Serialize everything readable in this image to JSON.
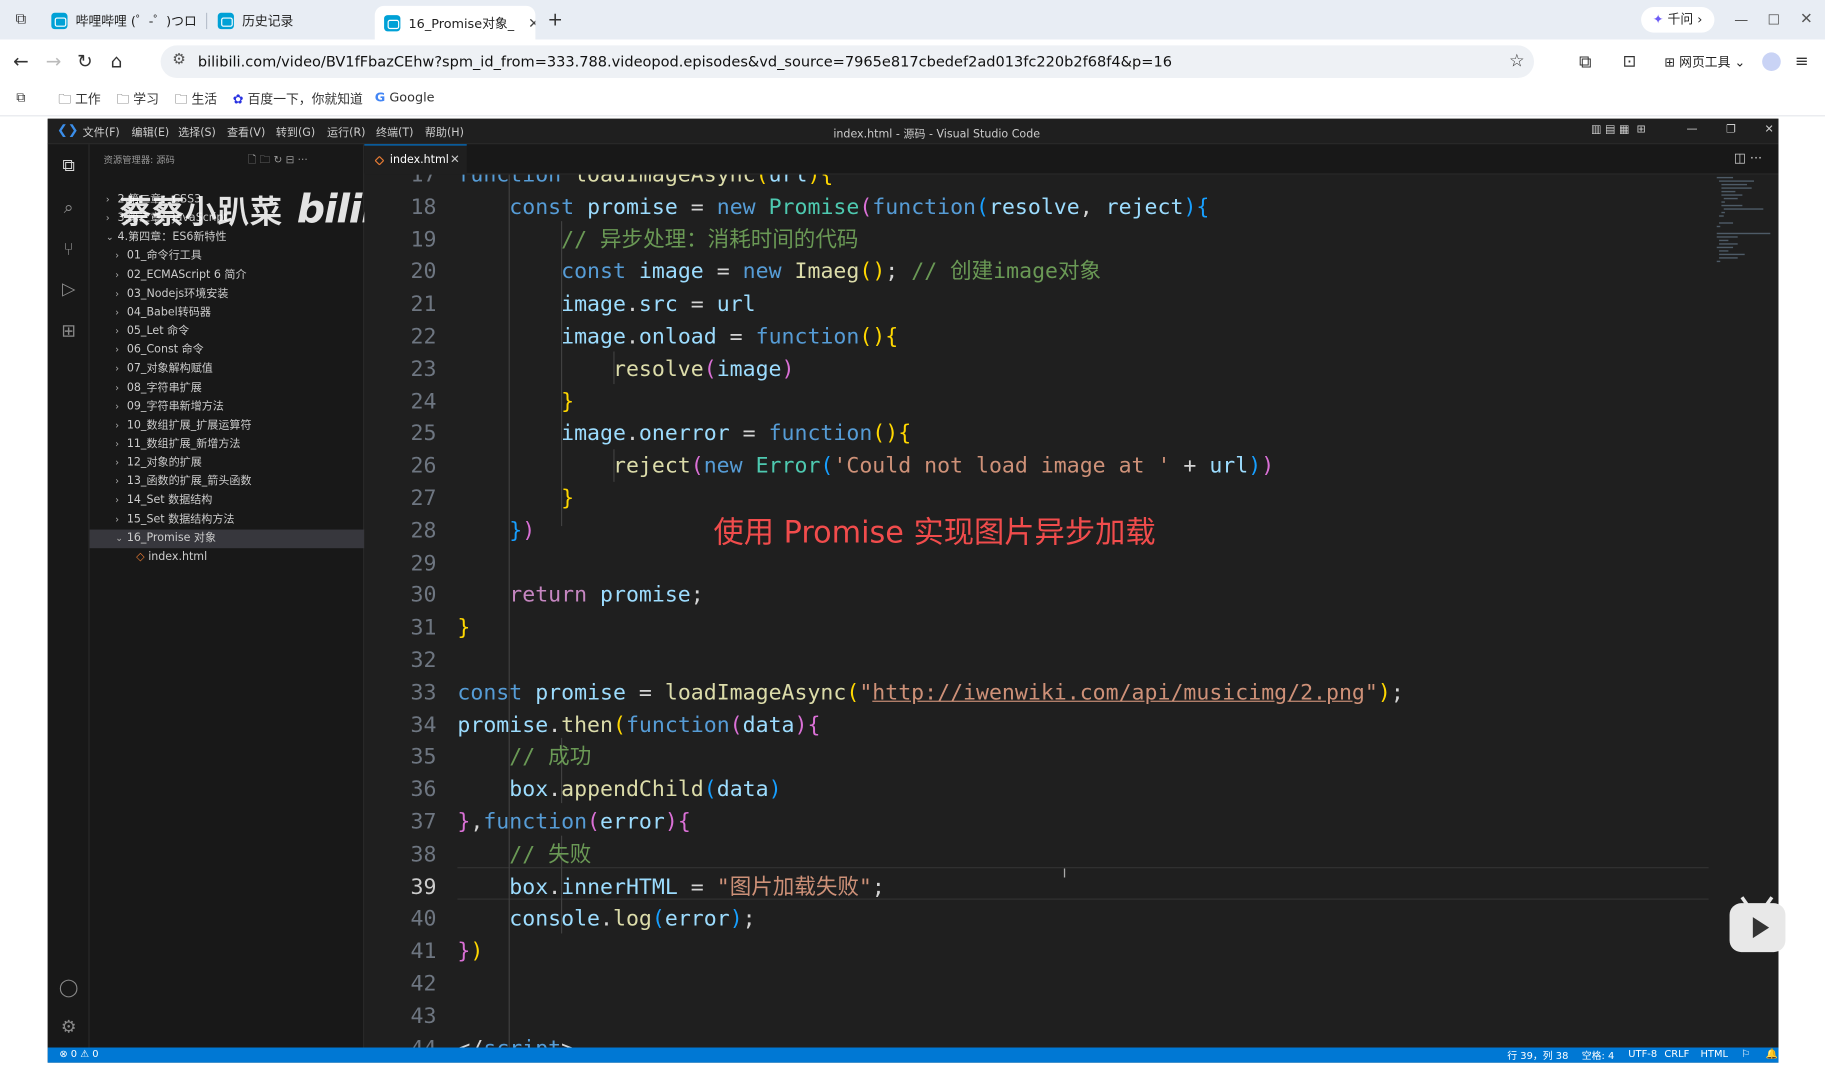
{
  "browser": {
    "tabs": [
      {
        "label": "哔哩哔哩 (゜-゜)つロ"
      },
      {
        "label": "历史记录"
      },
      {
        "label": "16_Promise对象_"
      }
    ],
    "qianwen": "千问",
    "url": "bilibili.com/video/BV1fFbazCEhw?spm_id_from=333.788.videopod.episodes&vd_source=7965e817cbedef2ad013fc220b2f68f4&p=16",
    "web_tools": "网页工具",
    "bookmarks": [
      "工作",
      "学习",
      "生活",
      "百度一下，你就知道",
      "Google"
    ]
  },
  "vscode": {
    "menu": [
      "文件(F)",
      "编辑(E)",
      "选择(S)",
      "查看(V)",
      "转到(G)",
      "运行(R)",
      "终端(T)",
      "帮助(H)"
    ],
    "title": "index.html - 源码 - Visual Studio Code",
    "explorer_header": "资源管理器: 源码",
    "tree": [
      {
        "label": "2.第二章：CSS3",
        "indent": 1,
        "chev": "›"
      },
      {
        "label": "3.第三章：JavaScript",
        "indent": 1,
        "chev": "›"
      },
      {
        "label": "4.第四章：ES6新特性",
        "indent": 1,
        "chev": "⌄"
      },
      {
        "label": "01_命令行工具",
        "indent": 2,
        "chev": "›"
      },
      {
        "label": "02_ECMAScript 6 简介",
        "indent": 2,
        "chev": "›"
      },
      {
        "label": "03_Nodejs环境安装",
        "indent": 2,
        "chev": "›"
      },
      {
        "label": "04_Babel转码器",
        "indent": 2,
        "chev": "›"
      },
      {
        "label": "05_Let 命令",
        "indent": 2,
        "chev": "›"
      },
      {
        "label": "06_Const 命令",
        "indent": 2,
        "chev": "›"
      },
      {
        "label": "07_对象解构赋值",
        "indent": 2,
        "chev": "›"
      },
      {
        "label": "08_字符串扩展",
        "indent": 2,
        "chev": "›"
      },
      {
        "label": "09_字符串新增方法",
        "indent": 2,
        "chev": "›"
      },
      {
        "label": "10_数组扩展_扩展运算符",
        "indent": 2,
        "chev": "›"
      },
      {
        "label": "11_数组扩展_新增方法",
        "indent": 2,
        "chev": "›"
      },
      {
        "label": "12_对象的扩展",
        "indent": 2,
        "chev": "›"
      },
      {
        "label": "13_函数的扩展_箭头函数",
        "indent": 2,
        "chev": "›"
      },
      {
        "label": "14_Set 数据结构",
        "indent": 2,
        "chev": "›"
      },
      {
        "label": "15_Set 数据结构方法",
        "indent": 2,
        "chev": "›"
      },
      {
        "label": "16_Promise 对象",
        "indent": 2,
        "chev": "⌄",
        "selected": true
      },
      {
        "label": "index.html",
        "indent": 3,
        "chev": "",
        "file": true
      }
    ],
    "editor_tab": "index.html",
    "watermark": {
      "name": "蔡蔡小趴菜",
      "brand": "bilibili"
    },
    "annotation": "使用 Promise 实现图片异步加载",
    "current_line": 39,
    "status": {
      "errors": "⊗ 0 ⚠ 0",
      "position": "行 39，列 38",
      "spaces": "空格: 4",
      "encoding": "UTF-8",
      "eol": "CRLF",
      "language": "HTML"
    }
  },
  "code_lines": [
    {
      "n": "17",
      "html": "<span class=\"k\">function</span> <span class=\"f\">loadImageAsync</span><span class=\"b1\">(</span><span class=\"v\">url</span><span class=\"b1\">){</span>"
    },
    {
      "n": "18",
      "html": "    <span class=\"k\">const</span> <span class=\"v\">promise</span> <span class=\"w\">=</span> <span class=\"k\">new</span> <span class=\"t\">Promise</span><span class=\"b2\">(</span><span class=\"k\">function</span><span class=\"b3\">(</span><span class=\"v\">resolve</span><span class=\"w\">,</span> <span class=\"v\">reject</span><span class=\"b3\">){</span>"
    },
    {
      "n": "19",
      "html": "        <span class=\"g\">// 异步处理：消耗时间的代码</span>"
    },
    {
      "n": "20",
      "html": "        <span class=\"k\">const</span> <span class=\"v\">image</span> <span class=\"w\">=</span> <span class=\"k\">new</span> <span class=\"f\">Imaeg</span><span class=\"b1\">()</span><span class=\"w\">;</span> <span class=\"g\">// 创建image对象</span>"
    },
    {
      "n": "21",
      "html": "        <span class=\"v\">image</span><span class=\"w\">.</span><span class=\"v\">src</span> <span class=\"w\">=</span> <span class=\"v\">url</span>"
    },
    {
      "n": "22",
      "html": "        <span class=\"v\">image</span><span class=\"w\">.</span><span class=\"v\">onload</span> <span class=\"w\">=</span> <span class=\"k\">function</span><span class=\"b1\">(){</span>"
    },
    {
      "n": "23",
      "html": "            <span class=\"f\">resolve</span><span class=\"b2\">(</span><span class=\"v\">image</span><span class=\"b2\">)</span>"
    },
    {
      "n": "24",
      "html": "        <span class=\"b1\">}</span>"
    },
    {
      "n": "25",
      "html": "        <span class=\"v\">image</span><span class=\"w\">.</span><span class=\"v\">onerror</span> <span class=\"w\">=</span> <span class=\"k\">function</span><span class=\"b1\">(){</span>"
    },
    {
      "n": "26",
      "html": "            <span class=\"f\">reject</span><span class=\"b2\">(</span><span class=\"k\">new</span> <span class=\"t\">Error</span><span class=\"b3\">(</span><span class=\"s\">'Could not load image at '</span> <span class=\"w\">+</span> <span class=\"v\">url</span><span class=\"b3\">)</span><span class=\"b2\">)</span>"
    },
    {
      "n": "27",
      "html": "        <span class=\"b1\">}</span>"
    },
    {
      "n": "28",
      "html": "    <span class=\"b3\">}</span><span class=\"b2\">)</span>"
    },
    {
      "n": "29",
      "html": ""
    },
    {
      "n": "30",
      "html": "    <span class=\"c\">return</span> <span class=\"v\">promise</span><span class=\"w\">;</span>"
    },
    {
      "n": "31",
      "html": "<span class=\"b1\">}</span>"
    },
    {
      "n": "32",
      "html": ""
    },
    {
      "n": "33",
      "html": "<span class=\"k\">const</span> <span class=\"v\">promise</span> <span class=\"w\">=</span> <span class=\"f\">loadImageAsync</span><span class=\"b1\">(</span><span class=\"s\">\"<span class=\"u\">http://iwenwiki.com/api/musicimg/2.png</span>\"</span><span class=\"b1\">)</span><span class=\"w\">;</span>"
    },
    {
      "n": "34",
      "html": "<span class=\"v\">promise</span><span class=\"w\">.</span><span class=\"f\">then</span><span class=\"b1\">(</span><span class=\"k\">function</span><span class=\"b2\">(</span><span class=\"v\">data</span><span class=\"b2\">){</span>"
    },
    {
      "n": "35",
      "html": "    <span class=\"g\">// 成功</span>"
    },
    {
      "n": "36",
      "html": "    <span class=\"v\">box</span><span class=\"w\">.</span><span class=\"f\">appendChild</span><span class=\"b3\">(</span><span class=\"v\">data</span><span class=\"b3\">)</span>"
    },
    {
      "n": "37",
      "html": "<span class=\"b2\">}</span><span class=\"w\">,</span><span class=\"k\">function</span><span class=\"b2\">(</span><span class=\"v\">error</span><span class=\"b2\">){</span>"
    },
    {
      "n": "38",
      "html": "    <span class=\"g\">// 失败</span>"
    },
    {
      "n": "39",
      "html": "    <span class=\"v\">box</span><span class=\"w\">.</span><span class=\"v\">innerHTML</span> <span class=\"w\">=</span> <span class=\"s\">\"图片加载失败\"</span><span class=\"w\">;</span>"
    },
    {
      "n": "40",
      "html": "    <span class=\"v\">console</span><span class=\"w\">.</span><span class=\"f\">log</span><span class=\"b3\">(</span><span class=\"v\">error</span><span class=\"b3\">)</span><span class=\"w\">;</span>"
    },
    {
      "n": "41",
      "html": "<span class=\"b2\">}</span><span class=\"b1\">)</span>"
    },
    {
      "n": "42",
      "html": ""
    },
    {
      "n": "43",
      "html": ""
    },
    {
      "n": "44",
      "html": "<span class=\"w\">&lt;/</span><span class=\"k\">script</span><span class=\"w\">&gt;</span>"
    }
  ]
}
